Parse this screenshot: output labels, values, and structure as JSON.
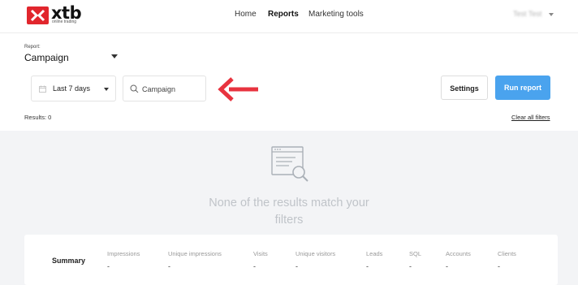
{
  "header": {
    "logo": {
      "text": "xtb",
      "tagline": "online trading",
      "brand_color": "#e1262d"
    },
    "nav": [
      {
        "label": "Home",
        "active": false
      },
      {
        "label": "Reports",
        "active": true
      },
      {
        "label": "Marketing tools",
        "active": false
      }
    ],
    "user": {
      "name": "Test Test"
    }
  },
  "report": {
    "label": "Report:",
    "value": "Campaign"
  },
  "filters": {
    "date_range": {
      "value": "Last 7 days",
      "icon": "calendar-icon"
    },
    "search": {
      "placeholder": "Campaign",
      "value": "",
      "icon": "search-icon"
    }
  },
  "actions": {
    "settings_label": "Settings",
    "run_label": "Run report",
    "run_color": "#4aa3ee"
  },
  "annotation": {
    "icon": "arrow-left-icon",
    "color": "#e8333f"
  },
  "results": {
    "label": "Results: 0",
    "clear_label": "Clear all filters"
  },
  "empty_state": {
    "icon": "document-search-icon",
    "message": "None of the results match your filters"
  },
  "summary": {
    "title": "Summary",
    "metrics": [
      {
        "label": "Impressions",
        "value": "-"
      },
      {
        "label": "Unique impressions",
        "value": "-"
      },
      {
        "label": "Visits",
        "value": "-"
      },
      {
        "label": "Unique visitors",
        "value": "-"
      },
      {
        "label": "Leads",
        "value": "-"
      },
      {
        "label": "SQL",
        "value": "-"
      },
      {
        "label": "Accounts",
        "value": "-"
      },
      {
        "label": "Clients",
        "value": "-"
      }
    ]
  }
}
